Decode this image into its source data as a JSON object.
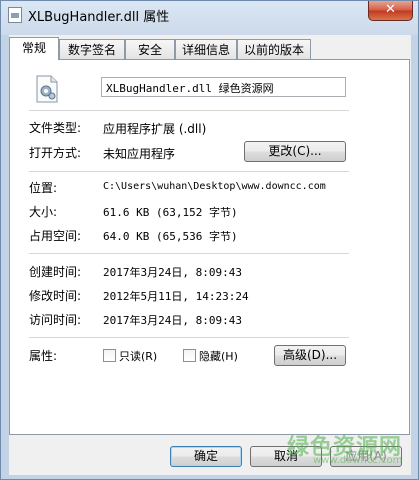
{
  "window": {
    "title": "XLBugHandler.dll 属性",
    "close_symbol": "✕"
  },
  "tabs": [
    {
      "label": "常规",
      "active": true
    },
    {
      "label": "数字签名",
      "active": false
    },
    {
      "label": "安全",
      "active": false
    },
    {
      "label": "详细信息",
      "active": false
    },
    {
      "label": "以前的版本",
      "active": false
    }
  ],
  "general": {
    "file_name": "XLBugHandler.dll 绿色资源网",
    "file_icon": "dll-file-icon",
    "type_label": "文件类型:",
    "type_value": "应用程序扩展 (.dll)",
    "open_with_label": "打开方式:",
    "open_with_value": "未知应用程序",
    "change_button": "更改(C)...",
    "location_label": "位置:",
    "location_value": "C:\\Users\\wuhan\\Desktop\\www.downcc.com",
    "size_label": "大小:",
    "size_value": "61.6 KB (63,152 字节)",
    "disk_size_label": "占用空间:",
    "disk_size_value": "64.0 KB (65,536 字节)",
    "created_label": "创建时间:",
    "created_value": "2017年3月24日, 8:09:43",
    "modified_label": "修改时间:",
    "modified_value": "2012年5月11日, 14:23:24",
    "accessed_label": "访问时间:",
    "accessed_value": "2017年3月24日, 8:09:43",
    "attributes_label": "属性:",
    "readonly_label": "只读(R)",
    "hidden_label": "隐藏(H)",
    "advanced_button": "高级(D)..."
  },
  "buttons": {
    "ok": "确定",
    "cancel": "取消",
    "apply": "应用(A)"
  },
  "watermark": {
    "text": "绿色资源网",
    "sub": "www.downcc.com"
  }
}
